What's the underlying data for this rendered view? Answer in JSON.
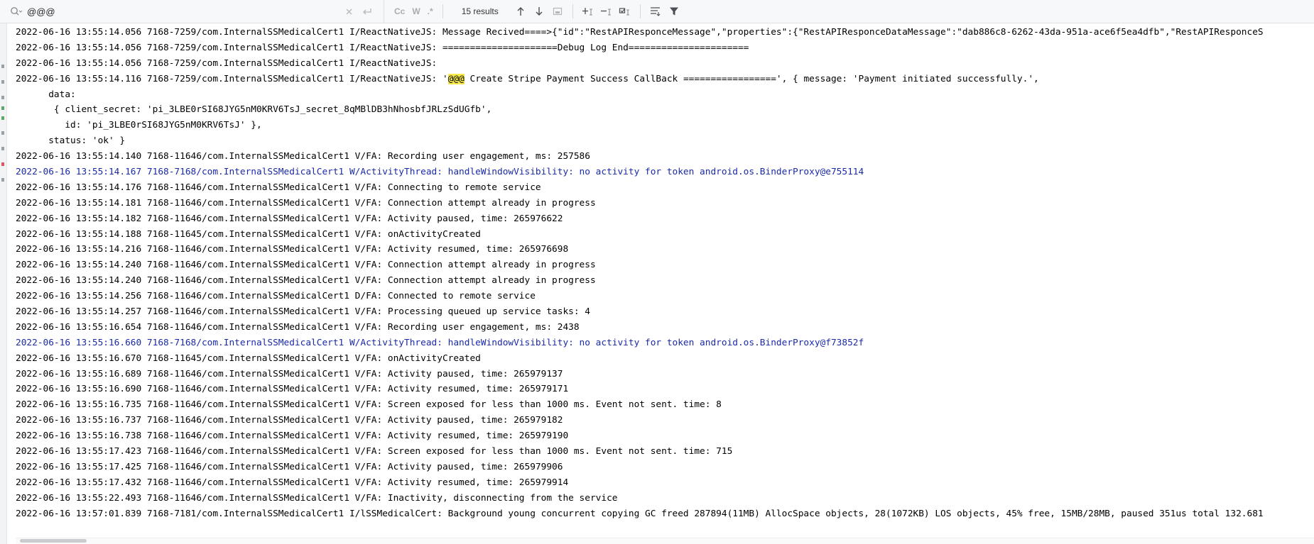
{
  "search": {
    "query": "@@@",
    "results_text": "15 results"
  },
  "toolbar": {
    "match_case_label": "Cc",
    "words_label": "W",
    "regex_label": ".*",
    "icons": [
      "search-icon",
      "clear-icon",
      "history-icon",
      "prev-arrow-icon",
      "next-arrow-icon",
      "in-selection-icon",
      "add-cursor-icon",
      "remove-cursor-icon",
      "select-all-occurrences-icon",
      "filter-lines-icon",
      "funnel-icon"
    ]
  },
  "colors": {
    "warn_text": "#1a2aa6",
    "highlight": "#f5e94b"
  },
  "log": {
    "lines": [
      {
        "text": "2022-06-16 13:55:14.056 7168-7259/com.InternalSSMedicalCert1 I/ReactNativeJS: Message Recived====>{\"id\":\"RestAPIResponceMessage\",\"properties\":{\"RestAPIResponceDataMessage\":\"dab886c8-6262-43da-951a-ace6f5ea4dfb\",\"RestAPIResponceS"
      },
      {
        "text": "2022-06-16 13:55:14.056 7168-7259/com.InternalSSMedicalCert1 I/ReactNativeJS: =====================Debug Log End======================"
      },
      {
        "text": "2022-06-16 13:55:14.056 7168-7259/com.InternalSSMedicalCert1 I/ReactNativeJS:"
      },
      {
        "pre": "2022-06-16 13:55:14.116 7168-7259/com.InternalSSMedicalCert1 I/ReactNativeJS: '",
        "match": "@@@",
        "post": " Create Stripe Payment Success CallBack =================', { message: 'Payment initiated successfully.',"
      },
      {
        "text": "      data:"
      },
      {
        "text": "       { client_secret: 'pi_3LBE0rSI68JYG5nM0KRV6TsJ_secret_8qMBlDB3hNhosbfJRLzSdUGfb',"
      },
      {
        "text": "         id: 'pi_3LBE0rSI68JYG5nM0KRV6TsJ' },"
      },
      {
        "text": "      status: 'ok' }"
      },
      {
        "text": "2022-06-16 13:55:14.140 7168-11646/com.InternalSSMedicalCert1 V/FA: Recording user engagement, ms: 257586"
      },
      {
        "text": "2022-06-16 13:55:14.167 7168-7168/com.InternalSSMedicalCert1 W/ActivityThread: handleWindowVisibility: no activity for token android.os.BinderProxy@e755114",
        "warn": true
      },
      {
        "text": "2022-06-16 13:55:14.176 7168-11646/com.InternalSSMedicalCert1 V/FA: Connecting to remote service"
      },
      {
        "text": "2022-06-16 13:55:14.181 7168-11646/com.InternalSSMedicalCert1 V/FA: Connection attempt already in progress"
      },
      {
        "text": "2022-06-16 13:55:14.182 7168-11646/com.InternalSSMedicalCert1 V/FA: Activity paused, time: 265976622"
      },
      {
        "text": "2022-06-16 13:55:14.188 7168-11645/com.InternalSSMedicalCert1 V/FA: onActivityCreated"
      },
      {
        "text": "2022-06-16 13:55:14.216 7168-11646/com.InternalSSMedicalCert1 V/FA: Activity resumed, time: 265976698"
      },
      {
        "text": "2022-06-16 13:55:14.240 7168-11646/com.InternalSSMedicalCert1 V/FA: Connection attempt already in progress"
      },
      {
        "text": "2022-06-16 13:55:14.240 7168-11646/com.InternalSSMedicalCert1 V/FA: Connection attempt already in progress"
      },
      {
        "text": "2022-06-16 13:55:14.256 7168-11646/com.InternalSSMedicalCert1 D/FA: Connected to remote service"
      },
      {
        "text": "2022-06-16 13:55:14.257 7168-11646/com.InternalSSMedicalCert1 V/FA: Processing queued up service tasks: 4"
      },
      {
        "text": "2022-06-16 13:55:16.654 7168-11646/com.InternalSSMedicalCert1 V/FA: Recording user engagement, ms: 2438"
      },
      {
        "text": "2022-06-16 13:55:16.660 7168-7168/com.InternalSSMedicalCert1 W/ActivityThread: handleWindowVisibility: no activity for token android.os.BinderProxy@f73852f",
        "warn": true
      },
      {
        "text": "2022-06-16 13:55:16.670 7168-11645/com.InternalSSMedicalCert1 V/FA: onActivityCreated"
      },
      {
        "text": "2022-06-16 13:55:16.689 7168-11646/com.InternalSSMedicalCert1 V/FA: Activity paused, time: 265979137"
      },
      {
        "text": "2022-06-16 13:55:16.690 7168-11646/com.InternalSSMedicalCert1 V/FA: Activity resumed, time: 265979171"
      },
      {
        "text": "2022-06-16 13:55:16.735 7168-11646/com.InternalSSMedicalCert1 V/FA: Screen exposed for less than 1000 ms. Event not sent. time: 8"
      },
      {
        "text": "2022-06-16 13:55:16.737 7168-11646/com.InternalSSMedicalCert1 V/FA: Activity paused, time: 265979182"
      },
      {
        "text": "2022-06-16 13:55:16.738 7168-11646/com.InternalSSMedicalCert1 V/FA: Activity resumed, time: 265979190"
      },
      {
        "text": "2022-06-16 13:55:17.423 7168-11646/com.InternalSSMedicalCert1 V/FA: Screen exposed for less than 1000 ms. Event not sent. time: 715"
      },
      {
        "text": "2022-06-16 13:55:17.425 7168-11646/com.InternalSSMedicalCert1 V/FA: Activity paused, time: 265979906"
      },
      {
        "text": "2022-06-16 13:55:17.432 7168-11646/com.InternalSSMedicalCert1 V/FA: Activity resumed, time: 265979914"
      },
      {
        "text": "2022-06-16 13:55:22.493 7168-11646/com.InternalSSMedicalCert1 V/FA: Inactivity, disconnecting from the service"
      },
      {
        "text": "2022-06-16 13:57:01.839 7168-7181/com.InternalSSMedicalCert1 I/lSSMedicalCert: Background young concurrent copying GC freed 287894(11MB) AllocSpace objects, 28(1072KB) LOS objects, 45% free, 15MB/28MB, paused 351us total 132.681"
      }
    ]
  }
}
